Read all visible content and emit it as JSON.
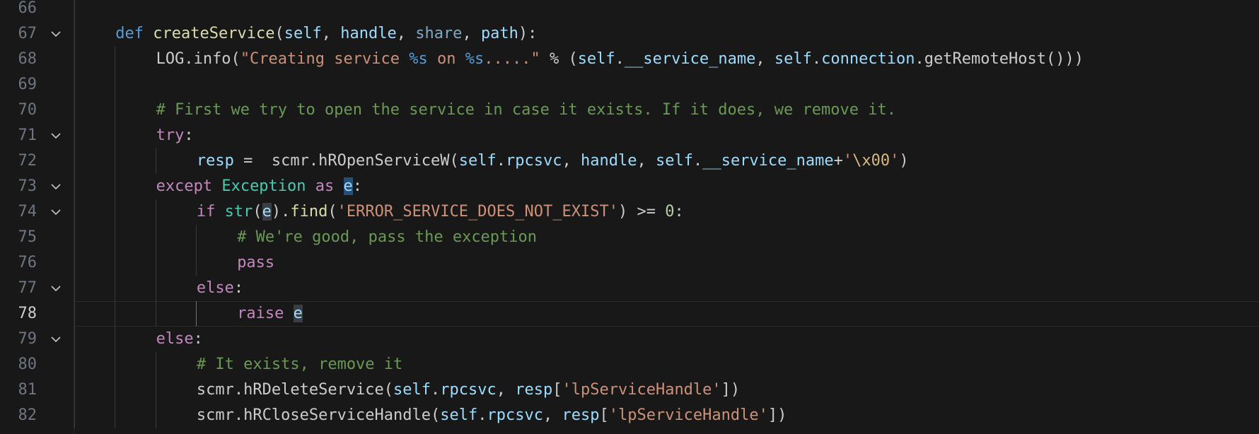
{
  "editor": {
    "language": "python",
    "current_line": "78",
    "colors": {
      "background": "#181818",
      "keyword": "#569cd6",
      "control": "#c586c0",
      "function": "#dcdcaa",
      "variable": "#9cdcfe",
      "string": "#ce9178",
      "comment": "#6a9955",
      "class": "#4ec9b0",
      "number": "#b5cea8"
    },
    "lines": [
      {
        "number": "66",
        "indent": 1,
        "fold": false,
        "tokens": []
      },
      {
        "number": "67",
        "indent": 1,
        "fold": true,
        "tokens": [
          {
            "t": "def",
            "c": "kw"
          },
          {
            "t": " ",
            "c": "plain"
          },
          {
            "t": "createService",
            "c": "fn"
          },
          {
            "t": "(",
            "c": "plain"
          },
          {
            "t": "self",
            "c": "var"
          },
          {
            "t": ", ",
            "c": "plain"
          },
          {
            "t": "handle",
            "c": "var"
          },
          {
            "t": ", ",
            "c": "plain"
          },
          {
            "t": "share",
            "c": "param-dim"
          },
          {
            "t": ", ",
            "c": "plain"
          },
          {
            "t": "path",
            "c": "var"
          },
          {
            "t": "):",
            "c": "plain"
          }
        ]
      },
      {
        "number": "68",
        "indent": 2,
        "fold": false,
        "tokens": [
          {
            "t": "LOG.info(",
            "c": "plain"
          },
          {
            "t": "\"Creating service ",
            "c": "str"
          },
          {
            "t": "%s",
            "c": "fmt"
          },
          {
            "t": " on ",
            "c": "str"
          },
          {
            "t": "%s",
            "c": "fmt"
          },
          {
            "t": ".....\"",
            "c": "str"
          },
          {
            "t": " % (",
            "c": "plain"
          },
          {
            "t": "self",
            "c": "var"
          },
          {
            "t": ".",
            "c": "plain"
          },
          {
            "t": "__service_name",
            "c": "var"
          },
          {
            "t": ", ",
            "c": "plain"
          },
          {
            "t": "self",
            "c": "var"
          },
          {
            "t": ".",
            "c": "plain"
          },
          {
            "t": "connection",
            "c": "var"
          },
          {
            "t": ".getRemoteHost()))",
            "c": "plain"
          }
        ]
      },
      {
        "number": "69",
        "indent": 2,
        "fold": false,
        "tokens": []
      },
      {
        "number": "70",
        "indent": 2,
        "fold": false,
        "tokens": [
          {
            "t": "# First we try to open the service in case it exists. If it does, we remove it.",
            "c": "com"
          }
        ]
      },
      {
        "number": "71",
        "indent": 2,
        "fold": true,
        "tokens": [
          {
            "t": "try",
            "c": "ctrl"
          },
          {
            "t": ":",
            "c": "plain"
          }
        ]
      },
      {
        "number": "72",
        "indent": 3,
        "fold": false,
        "tokens": [
          {
            "t": "resp",
            "c": "var"
          },
          {
            "t": " =  scmr.hROpenServiceW(",
            "c": "plain"
          },
          {
            "t": "self",
            "c": "var"
          },
          {
            "t": ".",
            "c": "plain"
          },
          {
            "t": "rpcsvc",
            "c": "var"
          },
          {
            "t": ", ",
            "c": "plain"
          },
          {
            "t": "handle",
            "c": "var"
          },
          {
            "t": ", ",
            "c": "plain"
          },
          {
            "t": "self",
            "c": "var"
          },
          {
            "t": ".",
            "c": "plain"
          },
          {
            "t": "__service_name",
            "c": "var"
          },
          {
            "t": "+",
            "c": "plain"
          },
          {
            "t": "'",
            "c": "str"
          },
          {
            "t": "\\x00",
            "c": "esc"
          },
          {
            "t": "'",
            "c": "str"
          },
          {
            "t": ")",
            "c": "plain"
          }
        ]
      },
      {
        "number": "73",
        "indent": 2,
        "fold": true,
        "tokens": [
          {
            "t": "except",
            "c": "ctrl"
          },
          {
            "t": " ",
            "c": "plain"
          },
          {
            "t": "Exception",
            "c": "cls"
          },
          {
            "t": " ",
            "c": "plain"
          },
          {
            "t": "as",
            "c": "ctrl"
          },
          {
            "t": " ",
            "c": "plain"
          },
          {
            "t": "e",
            "c": "var",
            "hl": "primary"
          },
          {
            "t": ":",
            "c": "plain"
          }
        ]
      },
      {
        "number": "74",
        "indent": 3,
        "fold": true,
        "tokens": [
          {
            "t": "if",
            "c": "ctrl"
          },
          {
            "t": " ",
            "c": "plain"
          },
          {
            "t": "str",
            "c": "cls"
          },
          {
            "t": "(",
            "c": "plain"
          },
          {
            "t": "e",
            "c": "var",
            "hl": "secondary"
          },
          {
            "t": ").",
            "c": "plain"
          },
          {
            "t": "find",
            "c": "fn"
          },
          {
            "t": "(",
            "c": "plain"
          },
          {
            "t": "'ERROR_SERVICE_DOES_NOT_EXIST'",
            "c": "str"
          },
          {
            "t": ") >= ",
            "c": "plain"
          },
          {
            "t": "0",
            "c": "num"
          },
          {
            "t": ":",
            "c": "plain"
          }
        ]
      },
      {
        "number": "75",
        "indent": 4,
        "fold": false,
        "tokens": [
          {
            "t": "# We're good, pass the exception",
            "c": "com"
          }
        ]
      },
      {
        "number": "76",
        "indent": 4,
        "fold": false,
        "tokens": [
          {
            "t": "pass",
            "c": "ctrl"
          }
        ]
      },
      {
        "number": "77",
        "indent": 3,
        "fold": true,
        "tokens": [
          {
            "t": "else",
            "c": "ctrl"
          },
          {
            "t": ":",
            "c": "plain"
          }
        ]
      },
      {
        "number": "78",
        "indent": 4,
        "fold": false,
        "tokens": [
          {
            "t": "raise",
            "c": "ctrl"
          },
          {
            "t": " ",
            "c": "plain"
          },
          {
            "t": "e",
            "c": "var",
            "hl": "secondary"
          }
        ]
      },
      {
        "number": "79",
        "indent": 2,
        "fold": true,
        "tokens": [
          {
            "t": "else",
            "c": "ctrl"
          },
          {
            "t": ":",
            "c": "plain"
          }
        ]
      },
      {
        "number": "80",
        "indent": 3,
        "fold": false,
        "tokens": [
          {
            "t": "# It exists, remove it",
            "c": "com"
          }
        ]
      },
      {
        "number": "81",
        "indent": 3,
        "fold": false,
        "tokens": [
          {
            "t": "scmr.hRDeleteService(",
            "c": "plain"
          },
          {
            "t": "self",
            "c": "var"
          },
          {
            "t": ".",
            "c": "plain"
          },
          {
            "t": "rpcsvc",
            "c": "var"
          },
          {
            "t": ", ",
            "c": "plain"
          },
          {
            "t": "resp",
            "c": "var"
          },
          {
            "t": "[",
            "c": "plain"
          },
          {
            "t": "'lpServiceHandle'",
            "c": "str"
          },
          {
            "t": "])",
            "c": "plain"
          }
        ]
      },
      {
        "number": "82",
        "indent": 3,
        "fold": false,
        "tokens": [
          {
            "t": "scmr.hRCloseServiceHandle(",
            "c": "plain"
          },
          {
            "t": "self",
            "c": "var"
          },
          {
            "t": ".",
            "c": "plain"
          },
          {
            "t": "rpcsvc",
            "c": "var"
          },
          {
            "t": ", ",
            "c": "plain"
          },
          {
            "t": "resp",
            "c": "var"
          },
          {
            "t": "[",
            "c": "plain"
          },
          {
            "t": "'lpServiceHandle'",
            "c": "str"
          },
          {
            "t": "])",
            "c": "plain"
          }
        ]
      }
    ]
  }
}
